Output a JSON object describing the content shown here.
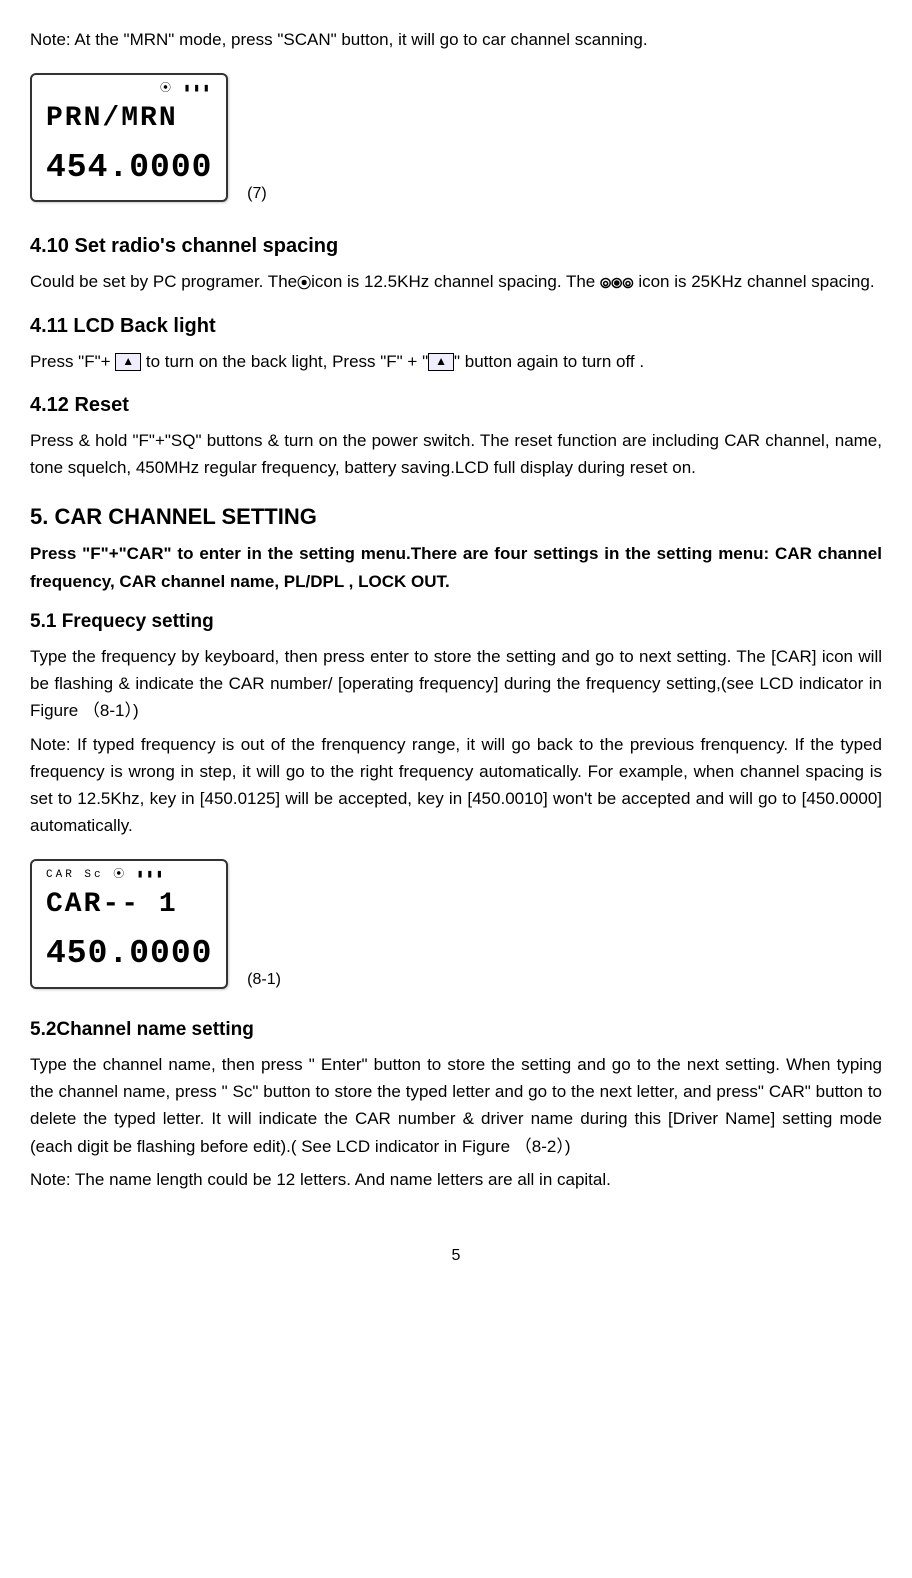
{
  "intro_note": "Note: At the \"MRN\" mode, press \"SCAN\" button, it will go to car channel scanning.",
  "lcd1": {
    "icons": "⦿ ▮▮▮",
    "line1": "PRN/MRN",
    "line2": "454.0000",
    "caption": "(7)"
  },
  "section410": {
    "title": "4.10 Set radio's channel spacing",
    "text_a": "Could be set by PC programer. The",
    "icon1": "⦿",
    "text_b": "icon is 12.5KHz channel spacing. The",
    "icon2": "⦾⦿⦾",
    "text_c": " icon is 25KHz channel spacing."
  },
  "section411": {
    "title": "4.11 LCD Back light",
    "text_a": "Press \"F\"+ ",
    "icon_up1": "▲",
    "text_b": " to turn on the back light, Press \"F\" + \"",
    "icon_up2": "▲",
    "text_c": "\" button again to turn off ."
  },
  "section412": {
    "title": "4.12 Reset",
    "text": "Press & hold \"F\"+\"SQ\" buttons & turn on the power switch. The reset function are including CAR channel, name, tone squelch, 450MHz regular frequency, battery saving.LCD full display during reset on."
  },
  "section5": {
    "title": "5.  CAR CHANNEL SETTING",
    "intro": "Press \"F\"+\"CAR\" to enter in the setting menu.There are four settings in the setting menu: CAR channel frequency, CAR channel name, PL/DPL , LOCK OUT."
  },
  "section51": {
    "title": "5.1 Frequecy setting",
    "para1": "Type the frequency by keyboard, then press enter to store the setting and go to next setting. The [CAR] icon will be flashing & indicate the CAR number/ [operating frequency] during the frequency setting,(see LCD indicator in Figure （8-1）)",
    "para2": "Note: If typed frequency is out of the frenquency range, it will go back to the previous frenquency. If the typed frequency is wrong in step, it will go to the right frequency automatically. For example, when channel spacing is set to 12.5Khz, key in [450.0125] will be accepted, key in [450.0010] won't be accepted and will go to [450.0000] automatically."
  },
  "lcd2": {
    "icons": "CAR        Sc ⦿ ▮▮▮",
    "line1": "CAR--   1",
    "line2": "450.0000",
    "caption": "(8-1)"
  },
  "section52": {
    "title": "5.2Channel name setting",
    "para1": "Type the channel name, then press \" Enter\" button to store the setting and go to the next setting. When typing the channel name, press \" Sc\" button to store the typed letter and go to the next letter, and press\" CAR\" button to delete the typed letter. It will indicate the CAR number & driver name during this [Driver Name] setting mode (each digit be flashing before edit).( See LCD indicator in Figure （8-2）)",
    "para2": "Note: The name length could be 12 letters. And name letters are all in capital."
  },
  "page_number": "5"
}
